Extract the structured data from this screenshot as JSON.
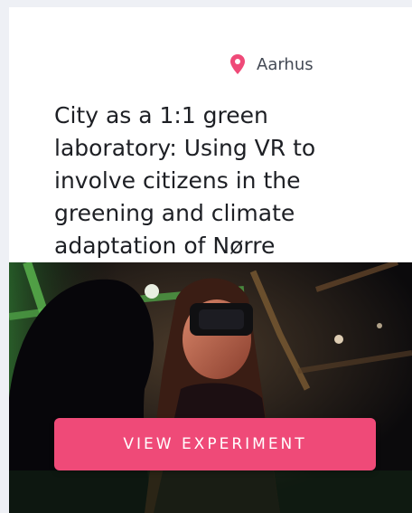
{
  "card": {
    "location": {
      "icon": "map-pin-icon",
      "label": "Aarhus"
    },
    "title": "City as a 1:1 green laboratory: Using VR to involve citizens in the greening and climate adaptation of Nørre",
    "cta_label": "VIEW EXPERIMENT"
  },
  "colors": {
    "accent": "#ef4a78",
    "page_bg": "#eef0f5",
    "card_bg": "#ffffff",
    "title_text": "#1d1f24"
  }
}
